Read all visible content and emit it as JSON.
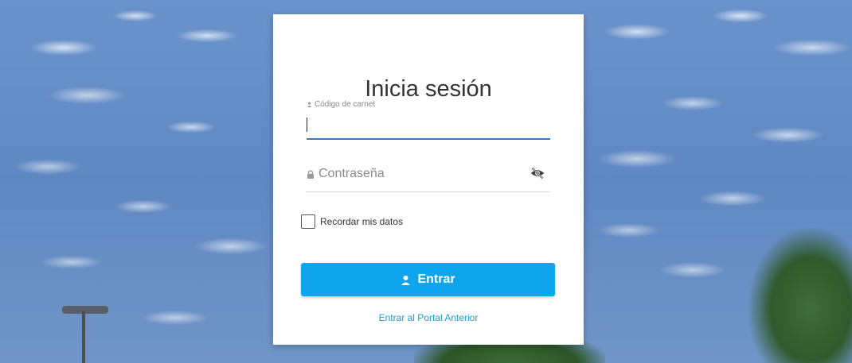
{
  "login": {
    "title": "Inicia sesión",
    "carnet_label": "Código de carnet",
    "carnet_value": "",
    "password_placeholder": "Contraseña",
    "remember_label": "Recordar mis datos",
    "remember_checked": false,
    "submit_label": "Entrar",
    "portal_link": "Entrar al Portal Anterior"
  },
  "icons": {
    "carnet": "person-icon",
    "password": "lock-icon",
    "toggle_visibility": "eye-slash-icon",
    "submit": "person-icon"
  },
  "colors": {
    "accent": "#0ea5ec",
    "focus_underline": "#3b78c2",
    "link": "#1a9fd6"
  }
}
